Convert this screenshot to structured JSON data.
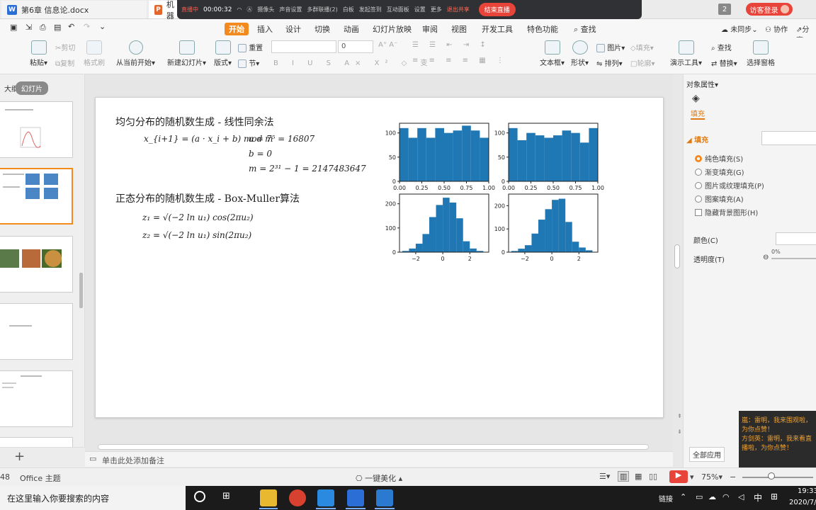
{
  "titlebar": {
    "tab1": "第6章 信息论.docx",
    "tab2": "机器",
    "badge": "2",
    "visitor": "访客登录"
  },
  "livebar": {
    "status": "直播中",
    "time": "00:00:32",
    "items": [
      "摄像头",
      "声音设置",
      "多群联播(2)",
      "白板",
      "发起签到",
      "互动面板",
      "设置",
      "更多"
    ],
    "stop_share": "退出共享",
    "end_live": "结束直播"
  },
  "menu": {
    "items": [
      "开始",
      "插入",
      "设计",
      "切换",
      "动画",
      "幻灯片放映",
      "审阅",
      "视图",
      "开发工具",
      "特色功能",
      "查找"
    ],
    "right": [
      "未同步",
      "协作",
      "分享"
    ]
  },
  "toolbar": {
    "paste": "粘贴",
    "cut": "剪切",
    "copy": "复制",
    "format_painter": "格式刷",
    "play_from_current": "从当前开始",
    "new_slide": "新建幻灯片",
    "layout": "版式",
    "reset": "重置",
    "section": "节",
    "font_size": "0",
    "textbox": "文本框",
    "shape": "形状",
    "picture": "图片",
    "fill": "填充",
    "arrange": "排列",
    "outline": "轮廓",
    "presentation_tools": "演示工具",
    "find": "查找",
    "replace": "替换",
    "selection_pane": "选择窗格"
  },
  "leftpanel": {
    "tab_outline": "大纲",
    "tab_slides": "幻灯片",
    "add": "+"
  },
  "slide": {
    "title1": "均匀分布的随机数生成 - 线性同余法",
    "lcg_formula": "x_{i+1} = (a · x_i + b) mod m",
    "a_value": "a = 7⁵ = 16807",
    "b_value": "b = 0",
    "m_value": "m = 2³¹ − 1 = 2147483647",
    "title2": "正态分布的随机数生成 - Box-Muller算法",
    "z1": "z₁ = √(−2 ln u₁) cos(2πu₂)",
    "z2": "z₂ = √(−2 ln u₁) sin(2πu₂)"
  },
  "chart_data": [
    {
      "type": "bar",
      "x": [
        0.05,
        0.15,
        0.25,
        0.35,
        0.45,
        0.55,
        0.65,
        0.75,
        0.85,
        0.95
      ],
      "values": [
        110,
        90,
        110,
        90,
        110,
        100,
        105,
        115,
        105,
        90
      ],
      "xlim": [
        0,
        1
      ],
      "ylim": [
        0,
        120
      ],
      "xticks": [
        "0.00",
        "0.25",
        "0.50",
        "0.75",
        "1.00"
      ],
      "yticks": [
        "0",
        "50",
        "100"
      ],
      "color": "#1f77b4"
    },
    {
      "type": "bar",
      "x": [
        0.05,
        0.15,
        0.25,
        0.35,
        0.45,
        0.55,
        0.65,
        0.75,
        0.85,
        0.95
      ],
      "values": [
        110,
        85,
        100,
        95,
        90,
        95,
        105,
        100,
        80,
        110
      ],
      "xlim": [
        0,
        1
      ],
      "ylim": [
        0,
        120
      ],
      "xticks": [
        "0.00",
        "0.25",
        "0.50",
        "0.75",
        "1.00"
      ],
      "yticks": [
        "0",
        "50",
        "100"
      ],
      "color": "#1f77b4"
    },
    {
      "type": "bar",
      "x": [
        -2.75,
        -2.25,
        -1.75,
        -1.25,
        -0.75,
        -0.25,
        0.25,
        0.75,
        1.25,
        1.75,
        2.25,
        2.75
      ],
      "values": [
        5,
        15,
        35,
        75,
        145,
        195,
        225,
        205,
        140,
        45,
        15,
        5
      ],
      "xlim": [
        -3.2,
        3.4
      ],
      "ylim": [
        0,
        240
      ],
      "xticks": [
        "−2",
        "0",
        "2"
      ],
      "yticks": [
        "0",
        "100",
        "200"
      ],
      "color": "#1f77b4"
    },
    {
      "type": "bar",
      "x": [
        -2.75,
        -2.25,
        -1.75,
        -1.25,
        -0.75,
        -0.25,
        0.25,
        0.75,
        1.25,
        1.75,
        2.25,
        2.75
      ],
      "values": [
        5,
        15,
        30,
        80,
        140,
        185,
        225,
        230,
        130,
        45,
        20,
        8
      ],
      "xlim": [
        -3.2,
        3.4
      ],
      "ylim": [
        0,
        250
      ],
      "xticks": [
        "−2",
        "0",
        "2"
      ],
      "yticks": [
        "0",
        "100",
        "200"
      ],
      "color": "#1f77b4"
    }
  ],
  "rightpanel": {
    "title": "对象属性",
    "fill_tab": "填充",
    "fill_section": "填充",
    "options": [
      "纯色填充(S)",
      "渐变填充(G)",
      "图片或纹理填充(P)",
      "图案填充(A)"
    ],
    "hide_bg": "隐藏背景图形(H)",
    "color_label": "颜色(C)",
    "transparency_label": "透明度(T)",
    "transparency_value": "0%",
    "apply_all": "全部应用"
  },
  "notes": {
    "placeholder": "单击此处添加备注"
  },
  "statusbar": {
    "slide_count": "48",
    "theme": "Office 主题",
    "beautify": "一键美化",
    "zoom": "75%"
  },
  "chat": {
    "msg1": "嵐：雷明，我来围观啦，为你点赞！",
    "msg2": "方剑英：雷明，我来看直播啦，为你点赞！"
  },
  "taskbar": {
    "search_placeholder": "在这里输入你要搜索的内容",
    "time": "19:33",
    "date": "2020/7/",
    "tray": [
      "链接",
      "中"
    ]
  }
}
